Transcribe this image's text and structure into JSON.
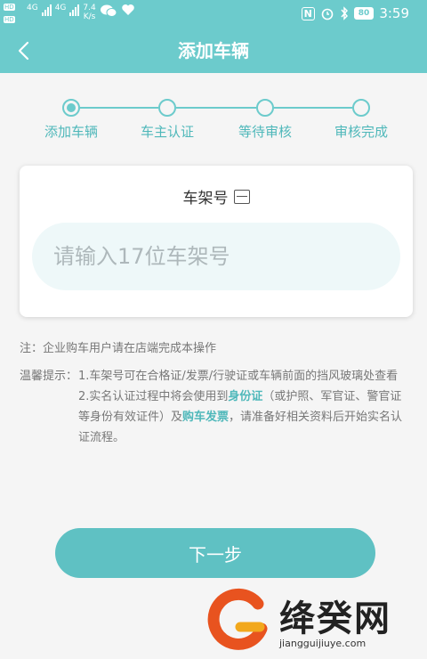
{
  "status_bar": {
    "hd1": "HD",
    "hd2": "HD",
    "net1": "4G",
    "net2": "4G",
    "speed_value": "7.4",
    "speed_unit": "K/s",
    "nfc": "N",
    "battery": "80",
    "time": "3:59",
    "icons": [
      "wechat-icon",
      "heart-icon",
      "nfc-icon",
      "alarm-icon",
      "bluetooth-icon",
      "battery-icon"
    ]
  },
  "header": {
    "title": "添加车辆"
  },
  "steps": [
    {
      "label": "添加车辆",
      "active": true
    },
    {
      "label": "车主认证",
      "active": false
    },
    {
      "label": "等待审核",
      "active": false
    },
    {
      "label": "审核完成",
      "active": false
    }
  ],
  "vin_card": {
    "title": "车架号",
    "placeholder": "请输入17位车架号",
    "value": ""
  },
  "notes": {
    "note_label": "注：",
    "note_text": "企业购车用户请在店端完成本操作",
    "tips_label": "温馨提示：",
    "tip1": "1.车架号可在合格证/发票/行驶证或车辆前面的挡风玻璃处查看",
    "tip2_a": "2.实名认证过程中将会使用到",
    "tip2_id": "身份证",
    "tip2_b": "（或护照、军官证、警官证等身份有效证件）及",
    "tip2_invoice": "购车发票",
    "tip2_c": "，请准备好相关资料后开始实名认证流程。"
  },
  "next_button": {
    "label": "下一步"
  },
  "watermark": {
    "name": "绛癸网",
    "url": "jiangguijiuye.com"
  },
  "colors": {
    "accent": "#6ccbcc",
    "accent_text": "#4fb8ba",
    "input_bg": "#eef8f9"
  }
}
